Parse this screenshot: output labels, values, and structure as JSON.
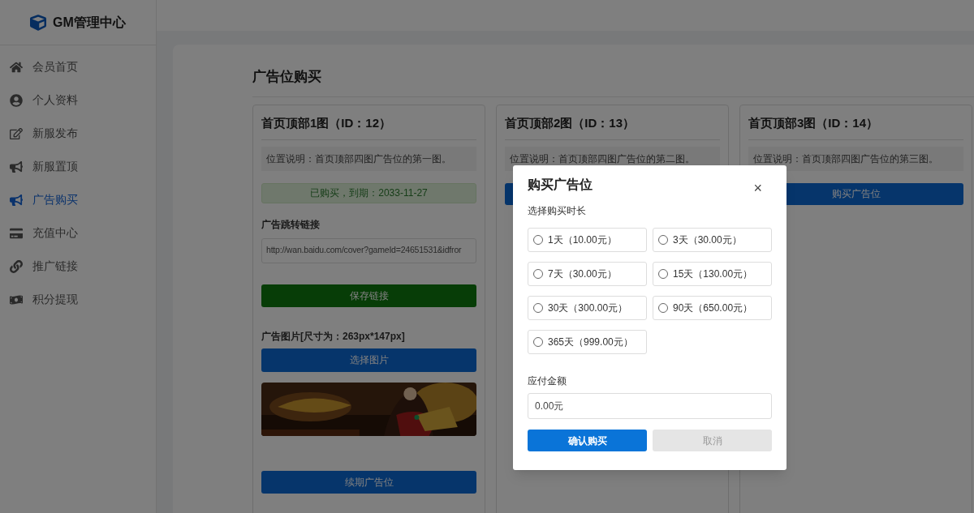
{
  "brand": {
    "title": "GM管理中心"
  },
  "sidebar": {
    "items": [
      {
        "label": "会员首页",
        "selected": false
      },
      {
        "label": "个人资料",
        "selected": false
      },
      {
        "label": "新服发布",
        "selected": false
      },
      {
        "label": "新服置顶",
        "selected": false
      },
      {
        "label": "广告购买",
        "selected": true
      },
      {
        "label": "充值中心",
        "selected": false
      },
      {
        "label": "推广链接",
        "selected": false
      },
      {
        "label": "积分提现",
        "selected": false
      }
    ]
  },
  "page": {
    "title": "广告位购买"
  },
  "cards": [
    {
      "kind": "purchased",
      "title": "首页顶部1图（ID：12）",
      "description": "位置说明：首页顶部四图广告位的第一图。",
      "status": "已购买，到期：2033-11-27",
      "link_label": "广告跳转链接",
      "link_value": "http://wan.baidu.com/cover?gameId=24651531&idfror",
      "save_button": "保存链接",
      "image_label": "广告图片[尺寸为：263px*147px]",
      "select_button": "选择图片",
      "renew_button": "续期广告位"
    },
    {
      "kind": "available",
      "title": "首页顶部2图（ID：13）",
      "description": "位置说明：首页顶部四图广告位的第二图。"
    },
    {
      "kind": "available",
      "title": "首页顶部3图（ID：14）",
      "description": "位置说明：首页顶部四图广告位的第三图。",
      "buy_button": "购买广告位"
    }
  ],
  "dialog": {
    "title": "购买广告位",
    "close": "×",
    "duration_label": "选择购买时长",
    "options": [
      {
        "label": "1天（10.00元）",
        "selected": false
      },
      {
        "label": "3天（30.00元）",
        "selected": false
      },
      {
        "label": "7天（30.00元）",
        "selected": false
      },
      {
        "label": "15天（130.00元）",
        "selected": false
      },
      {
        "label": "30天（300.00元）",
        "selected": false
      },
      {
        "label": "90天（650.00元）",
        "selected": false
      },
      {
        "label": "365天（999.00元）",
        "selected": false
      }
    ],
    "amount_label": "应付金额",
    "amount_value": "0.00元",
    "confirm_button": "确认购买",
    "cancel_button": "取消"
  }
}
